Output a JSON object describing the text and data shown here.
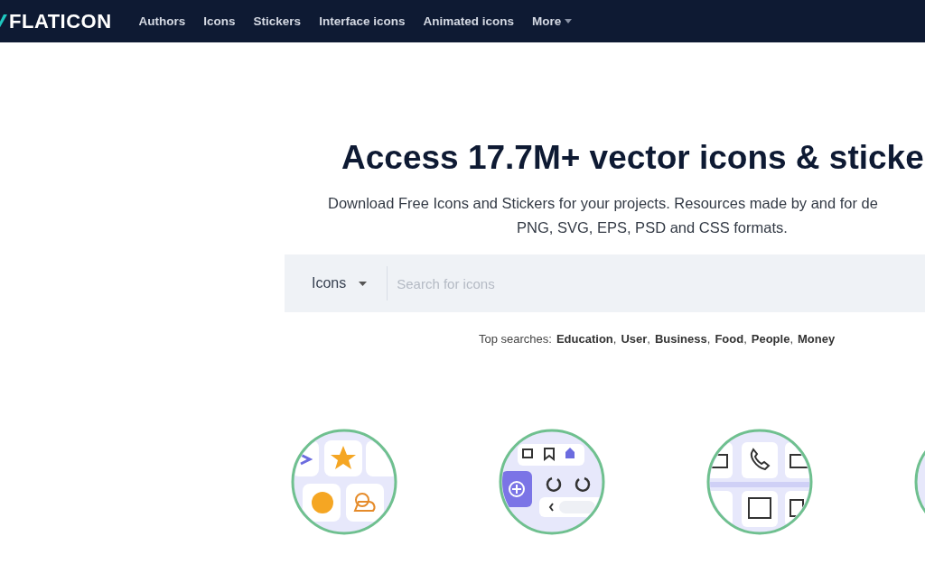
{
  "nav": {
    "logo": "FLATICON",
    "items": [
      {
        "label": "Authors",
        "kind": "link"
      },
      {
        "label": "Icons",
        "kind": "link"
      },
      {
        "label": "Stickers",
        "kind": "link"
      },
      {
        "label": "Interface icons",
        "kind": "link"
      },
      {
        "label": "Animated icons",
        "kind": "link"
      },
      {
        "label": "More",
        "kind": "dropdown"
      }
    ]
  },
  "hero": {
    "title": "Access 17.7M+ vector icons & sticke",
    "subtitle_lines": [
      "Download Free Icons and Stickers for your projects. Resources made by and for de",
      "PNG, SVG, EPS, PSD and CSS formats."
    ]
  },
  "search": {
    "category": "Icons",
    "placeholder": "Search for icons"
  },
  "top_searches": {
    "label": "Top searches:",
    "terms": [
      {
        "label": "Education",
        "separator": ","
      },
      {
        "label": "User",
        "separator": ","
      },
      {
        "label": "Business",
        "separator": ","
      },
      {
        "label": "Food",
        "separator": ","
      },
      {
        "label": "People",
        "separator": ","
      },
      {
        "label": "Money"
      }
    ]
  },
  "collections": [
    {
      "kind": "mixed"
    },
    {
      "kind": "interface"
    },
    {
      "kind": "business"
    },
    {
      "kind": "partial"
    }
  ]
}
